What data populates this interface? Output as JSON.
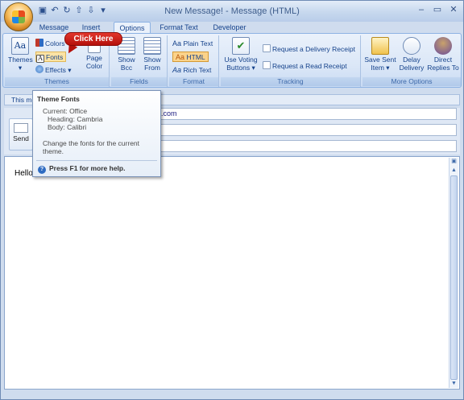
{
  "window": {
    "title": "New Message! - Message (HTML)"
  },
  "quick_access": [
    "save-icon",
    "undo-icon",
    "redo-icon",
    "up-arrow-icon",
    "down-arrow-icon",
    "customize-icon"
  ],
  "tabs": [
    {
      "label": "Message"
    },
    {
      "label": "Insert"
    },
    {
      "label": "Options"
    },
    {
      "label": "Format Text"
    },
    {
      "label": "Developer"
    }
  ],
  "ribbon": {
    "themes": {
      "themes_label": "Themes",
      "colors_label": "Colors",
      "fonts_label": "Fonts",
      "effects_label": "Effects",
      "page_color_label": "Page Color",
      "group_label": "Themes"
    },
    "fields": {
      "show_bcc": "Show Bcc",
      "show_from": "Show From",
      "group_label": "Fields"
    },
    "format": {
      "plain_text": "Plain Text",
      "html": "HTML",
      "rich_text": "Rich Text",
      "group_label": "Format"
    },
    "tracking": {
      "use_voting_buttons": "Use Voting Buttons",
      "delivery_receipt": "Request a Delivery Receipt",
      "read_receipt": "Request a Read Receipt",
      "group_label": "Tracking"
    },
    "more_options": {
      "save_sent_item": "Save Sent Item",
      "delay_delivery": "Delay Delivery",
      "direct_replies": "Direct Replies To",
      "group_label": "More Options"
    }
  },
  "infobar": {
    "text": "This me"
  },
  "compose": {
    "send_label": "Send",
    "to_value": ".com",
    "body_text": "Hello!"
  },
  "tooltip": {
    "title": "Theme Fonts",
    "current": "Current: Office",
    "heading": "Heading: Cambria",
    "body": "Body: Calibri",
    "description": "Change the fonts for the current theme.",
    "help": "Press F1 for more help."
  },
  "callout": {
    "text": "Click Here"
  },
  "colors": {
    "accent": "#15428b",
    "callout": "#c8211a"
  }
}
